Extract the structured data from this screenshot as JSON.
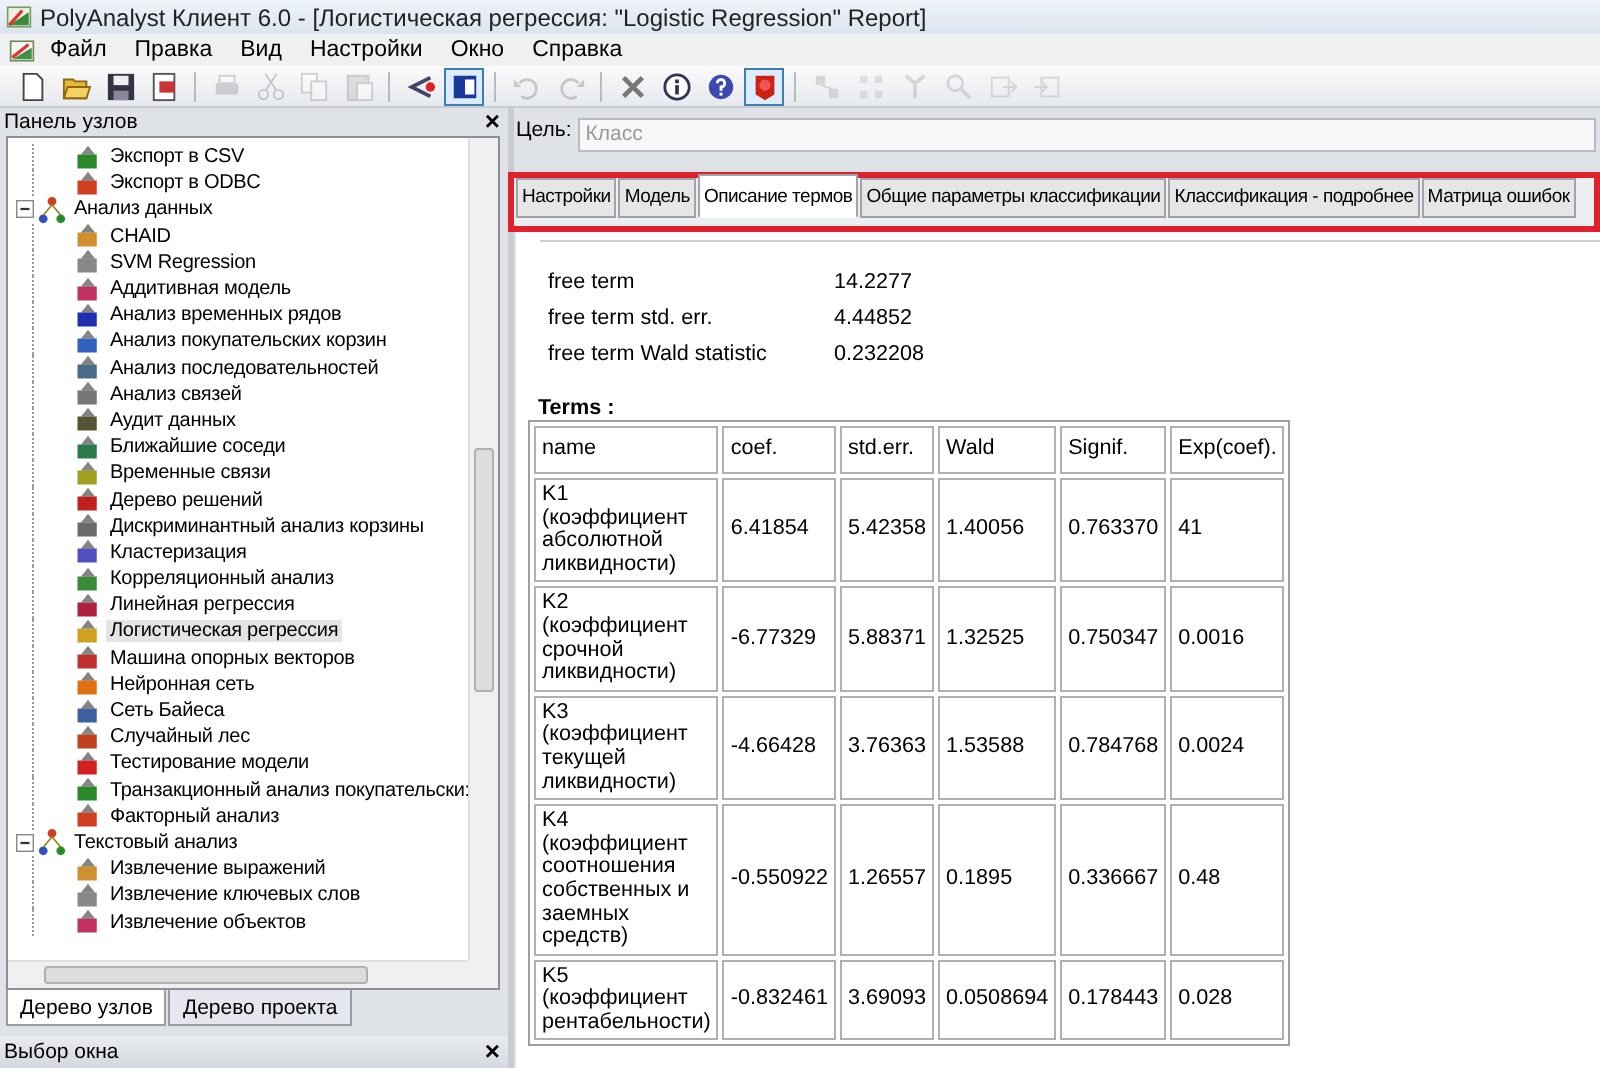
{
  "window": {
    "title": "PolyAnalyst Клиент 6.0 - [Логистическая регрессия: \"Logistic Regression\" Report]"
  },
  "menu": [
    "Файл",
    "Правка",
    "Вид",
    "Настройки",
    "Окно",
    "Справка"
  ],
  "toolbar": [
    [
      {
        "kind": "new",
        "disabled": false,
        "pressed": false
      },
      {
        "kind": "open",
        "disabled": false,
        "pressed": false
      },
      {
        "kind": "save",
        "disabled": false,
        "pressed": false
      },
      {
        "kind": "report",
        "disabled": false,
        "pressed": false
      }
    ],
    [
      {
        "kind": "print",
        "disabled": true,
        "pressed": false
      },
      {
        "kind": "cut",
        "disabled": true,
        "pressed": false
      },
      {
        "kind": "copy",
        "disabled": true,
        "pressed": false
      },
      {
        "kind": "paste",
        "disabled": true,
        "pressed": false
      }
    ],
    [
      {
        "kind": "graph",
        "disabled": false,
        "pressed": false
      },
      {
        "kind": "window",
        "disabled": false,
        "pressed": true
      }
    ],
    [
      {
        "kind": "undo",
        "disabled": true,
        "pressed": false
      },
      {
        "kind": "redo",
        "disabled": true,
        "pressed": false
      }
    ],
    [
      {
        "kind": "delete",
        "disabled": false,
        "pressed": false
      },
      {
        "kind": "info",
        "disabled": false,
        "pressed": false
      },
      {
        "kind": "help",
        "disabled": false,
        "pressed": false
      },
      {
        "kind": "marker",
        "disabled": false,
        "pressed": true
      }
    ],
    [
      {
        "kind": "nodes",
        "disabled": true,
        "pressed": false
      },
      {
        "kind": "grid",
        "disabled": true,
        "pressed": false
      },
      {
        "kind": "branch",
        "disabled": true,
        "pressed": false
      },
      {
        "kind": "search",
        "disabled": true,
        "pressed": false
      },
      {
        "kind": "export",
        "disabled": true,
        "pressed": false
      },
      {
        "kind": "import",
        "disabled": true,
        "pressed": false
      }
    ]
  ],
  "node_panel": {
    "title": "Панель узлов",
    "close": "×",
    "tree": [
      {
        "kind": "continuation",
        "children": [
          {
            "label": "Экспорт в CSV",
            "selected": false
          },
          {
            "label": "Экспорт в ODBC",
            "selected": false
          }
        ]
      },
      {
        "kind": "group",
        "label": "Анализ данных",
        "expanded": true,
        "children": [
          {
            "label": "CHAID",
            "selected": false
          },
          {
            "label": "SVM Regression",
            "selected": false
          },
          {
            "label": "Аддитивная модель",
            "selected": false
          },
          {
            "label": "Анализ временных рядов",
            "selected": false
          },
          {
            "label": "Анализ покупательских корзин",
            "selected": false
          },
          {
            "label": "Анализ последовательностей",
            "selected": false
          },
          {
            "label": "Анализ связей",
            "selected": false
          },
          {
            "label": "Аудит данных",
            "selected": false
          },
          {
            "label": "Ближайшие соседи",
            "selected": false
          },
          {
            "label": "Временные связи",
            "selected": false
          },
          {
            "label": "Дерево решений",
            "selected": false
          },
          {
            "label": "Дискриминантный анализ корзины",
            "selected": false
          },
          {
            "label": "Кластеризация",
            "selected": false
          },
          {
            "label": "Корреляционный анализ",
            "selected": false
          },
          {
            "label": "Линейная регрессия",
            "selected": false
          },
          {
            "label": "Логистическая регрессия",
            "selected": true
          },
          {
            "label": "Машина опорных векторов",
            "selected": false
          },
          {
            "label": "Нейронная сеть",
            "selected": false
          },
          {
            "label": "Сеть Байеса",
            "selected": false
          },
          {
            "label": "Случайный лес",
            "selected": false
          },
          {
            "label": "Тестирование модели",
            "selected": false
          },
          {
            "label": "Транзакционный анализ покупательски:",
            "selected": false
          },
          {
            "label": "Факторный анализ",
            "selected": false
          }
        ]
      },
      {
        "kind": "group",
        "label": "Текстовый анализ",
        "expanded": true,
        "children": [
          {
            "label": "Извлечение выражений",
            "selected": false
          },
          {
            "label": "Извлечение ключевых слов",
            "selected": false
          },
          {
            "label": "Извлечение объектов",
            "selected": false
          }
        ]
      }
    ],
    "tabs": [
      {
        "label": "Дерево узлов",
        "selected": true
      },
      {
        "label": "Дерево проекта",
        "selected": false
      }
    ]
  },
  "window_panel": {
    "title": "Выбор окна",
    "close": "×"
  },
  "report": {
    "target_label": "Цель:",
    "target_placeholder": "Класс",
    "tabs_highlighted": true,
    "tabs": [
      {
        "label": "Настройки",
        "selected": false
      },
      {
        "label": "Модель",
        "selected": false
      },
      {
        "label": "Описание термов",
        "selected": true
      },
      {
        "label": "Общие параметры классификации",
        "selected": false
      },
      {
        "label": "Классификация - подробнее",
        "selected": false
      },
      {
        "label": "Матрица ошибок",
        "selected": false
      }
    ],
    "free_terms": [
      {
        "name": "free term",
        "value": "14.2277"
      },
      {
        "name": "free term std. err.",
        "value": "4.44852"
      },
      {
        "name": "free term Wald statistic",
        "value": "0.232208"
      }
    ],
    "terms_title": "Terms :",
    "table": {
      "columns": [
        "name",
        "coef.",
        "std.err.",
        "Wald",
        "Signif.",
        "Exp(coef)."
      ],
      "rows": [
        [
          "K1 (коэффициент абсолютной ликвидности)",
          "6.41854",
          "5.42358",
          "1.40056",
          "0.763370",
          "41"
        ],
        [
          "K2 (коэффициент срочной ликвидности)",
          "-6.77329",
          "5.88371",
          "1.32525",
          "0.750347",
          "0.0016"
        ],
        [
          "K3 (коэффициент текущей ликвидности)",
          "-4.66428",
          "3.76363",
          "1.53588",
          "0.784768",
          "0.0024"
        ],
        [
          "K4 (коэффициент соотношения собственных и заемных средств)",
          "-0.550922",
          "1.26557",
          "0.1895",
          "0.336667",
          "0.48"
        ],
        [
          "K5 (коэффициент рентабельности)",
          "-0.832461",
          "3.69093",
          "0.0508694",
          "0.178443",
          "0.028"
        ]
      ]
    }
  }
}
